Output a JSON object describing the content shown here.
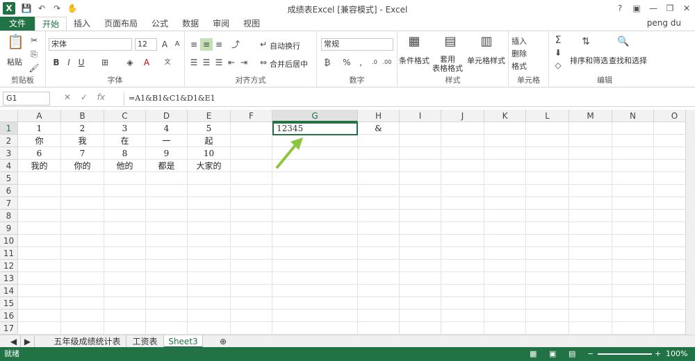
{
  "window": {
    "title": "成绩表Excel  [兼容模式] - Excel",
    "help": "?",
    "ribbon_opts": "▣",
    "minimize": "—",
    "restore": "❐",
    "close": "✕"
  },
  "tabs": {
    "file": "文件",
    "items": [
      "开始",
      "插入",
      "页面布局",
      "公式",
      "数据",
      "审阅",
      "视图"
    ],
    "user": "peng du"
  },
  "ribbon": {
    "clipboard": {
      "paste": "粘贴",
      "label": "剪贴板"
    },
    "font": {
      "name": "宋体",
      "size": "12",
      "label": "字体"
    },
    "alignment": {
      "wrap": "自动换行",
      "merge": "合并后居中",
      "label": "对齐方式"
    },
    "number": {
      "format": "常规",
      "label": "数字"
    },
    "styles": {
      "conditional": "条件格式",
      "table": "套用\n表格格式",
      "cell": "单元格样式",
      "label": "样式"
    },
    "cells": {
      "insert": "插入",
      "delete": "删除",
      "format": "格式",
      "label": "单元格"
    },
    "editing": {
      "sort": "排序和筛选",
      "find": "查找和选择",
      "label": "编辑"
    }
  },
  "formula_bar": {
    "name_box": "G1",
    "formula": "=A1&B1&C1&D1&E1"
  },
  "columns": [
    "A",
    "B",
    "C",
    "D",
    "E",
    "F",
    "G",
    "H",
    "I",
    "J",
    "K",
    "L",
    "M",
    "N",
    "O"
  ],
  "rows": [
    "1",
    "2",
    "3",
    "4",
    "5",
    "6",
    "7",
    "8",
    "9",
    "10",
    "11",
    "12",
    "13",
    "14",
    "15",
    "16",
    "17"
  ],
  "cells": [
    [
      "1",
      "2",
      "3",
      "4",
      "5",
      "",
      "12345",
      "&"
    ],
    [
      "你",
      "我",
      "在",
      "一",
      "起"
    ],
    [
      "6",
      "7",
      "8",
      "9",
      "10"
    ],
    [
      "我的",
      "你的",
      "他的",
      "都是",
      "大家的"
    ]
  ],
  "sheet_tabs": [
    "五年级成绩统计表",
    "工资表",
    "Sheet3"
  ],
  "status": {
    "mode": "就绪",
    "zoom": "100%"
  }
}
